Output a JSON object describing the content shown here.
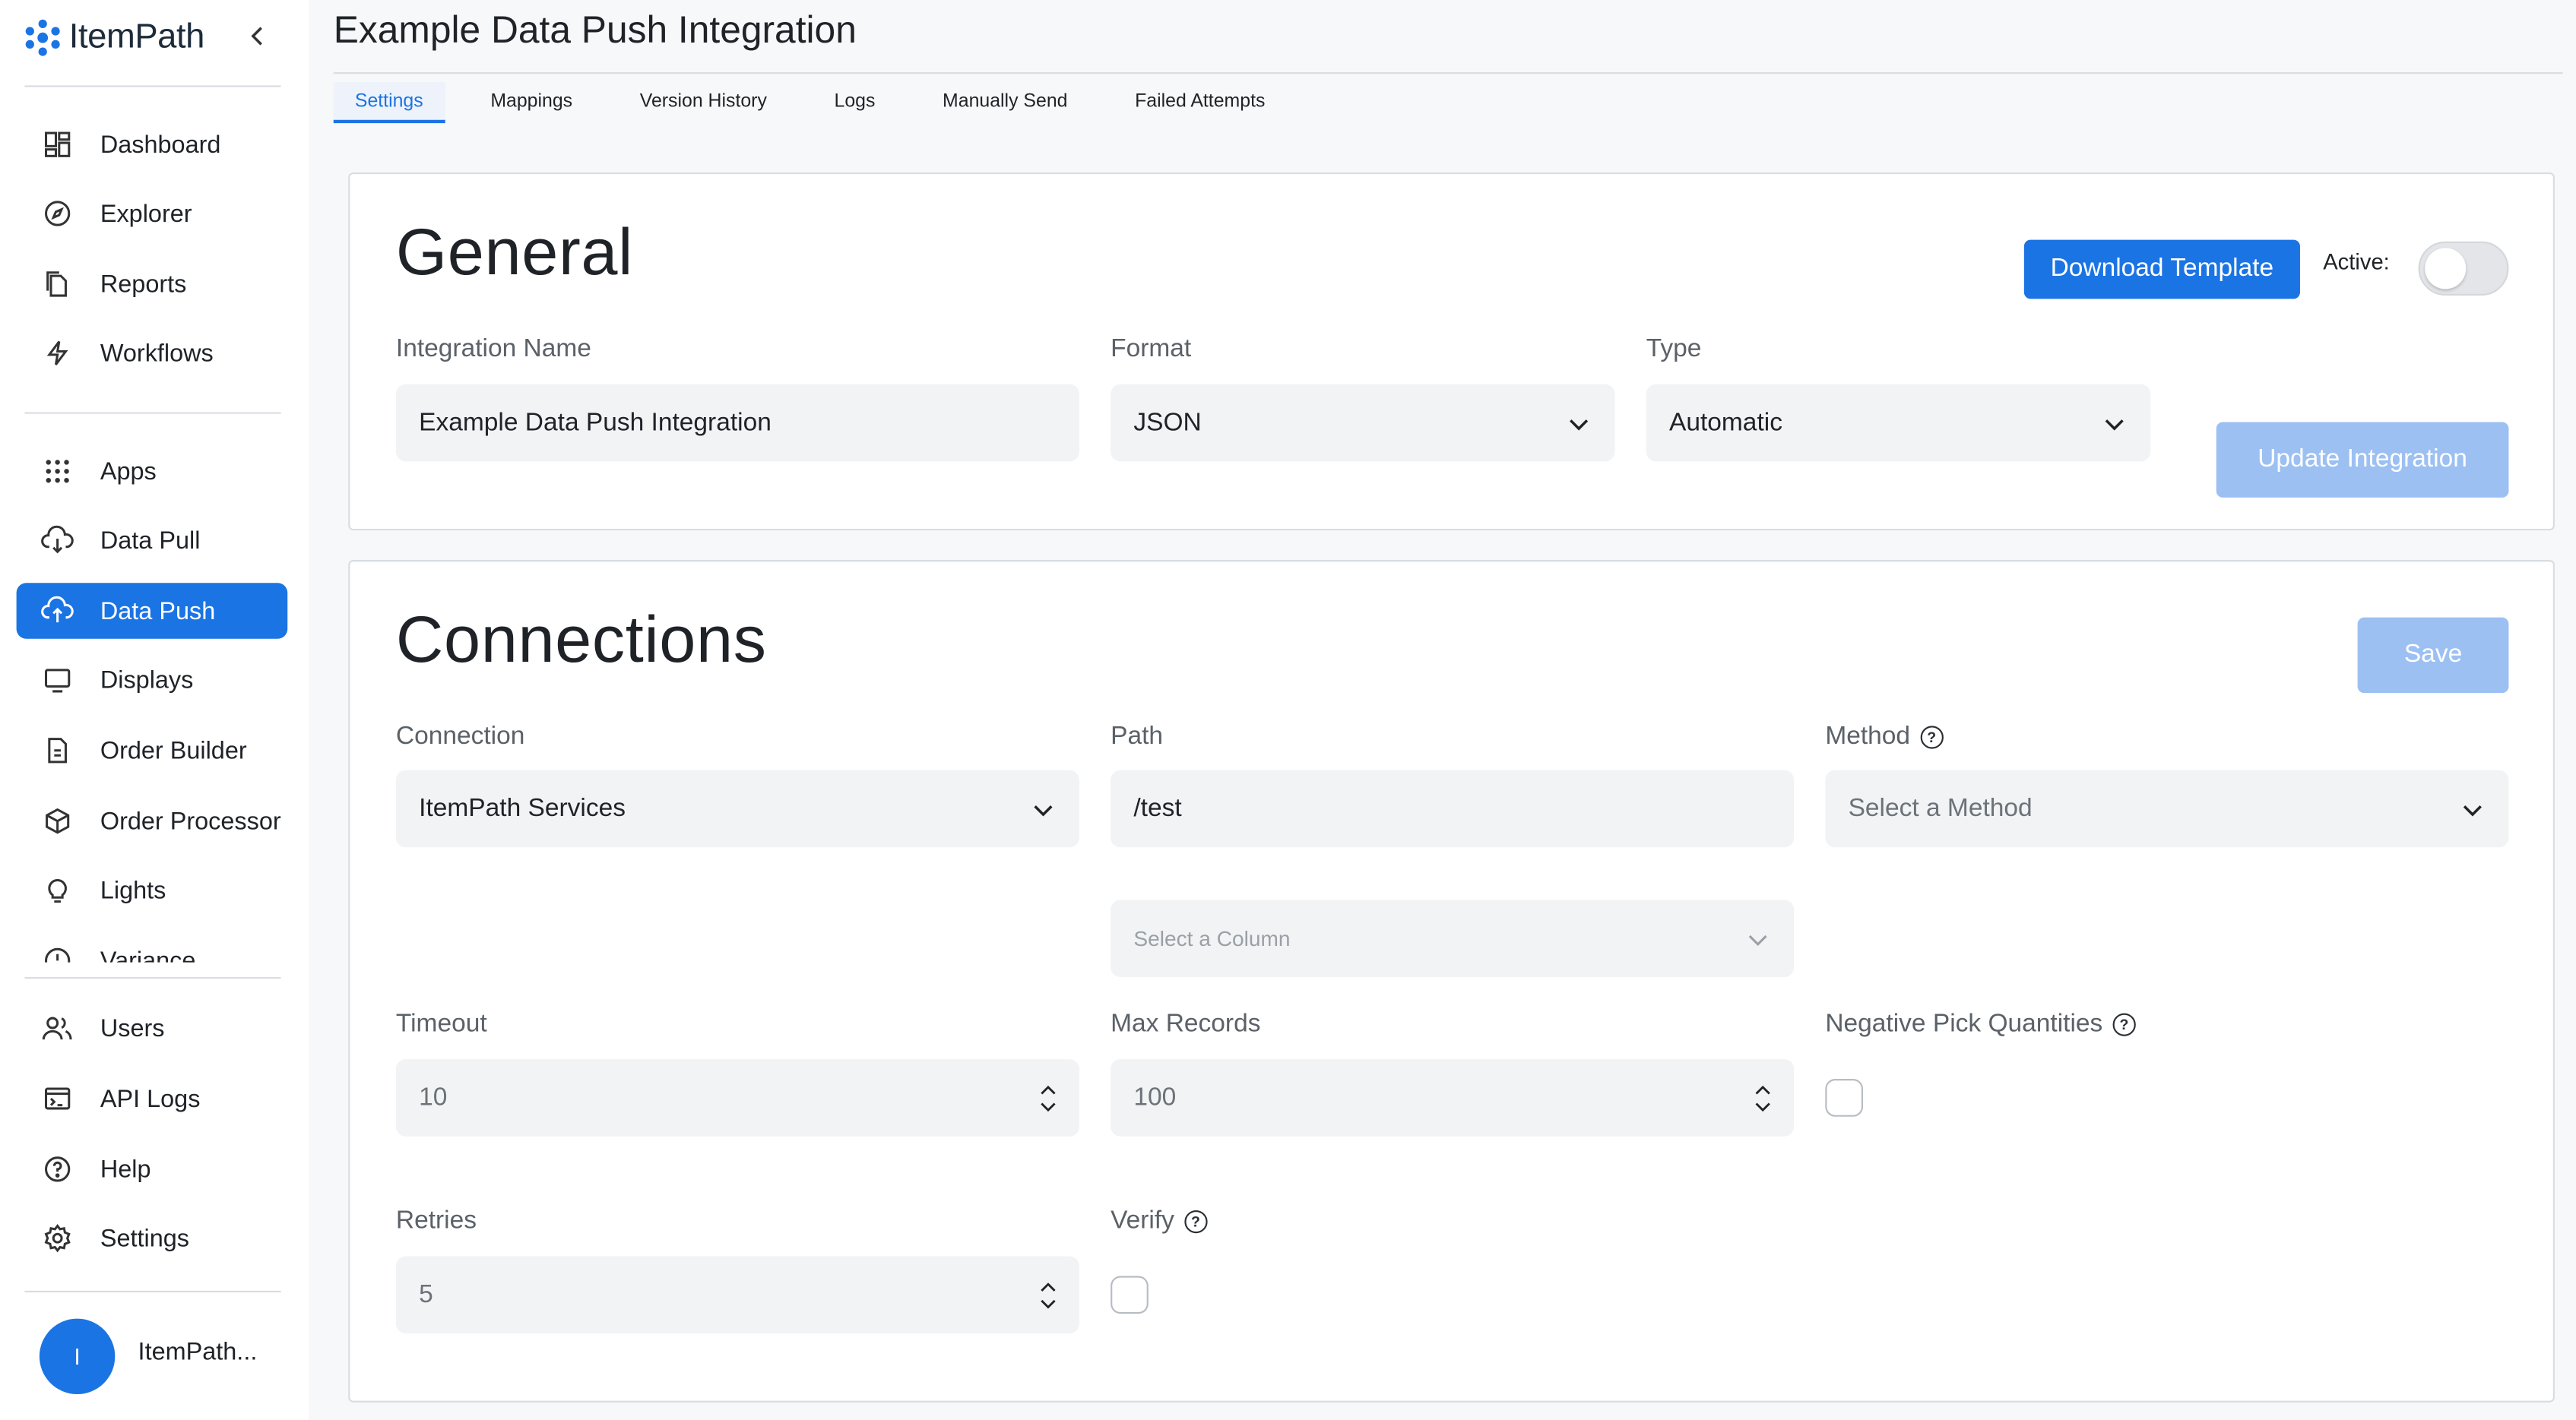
{
  "brand": {
    "name": "ItemPath"
  },
  "sidebar": {
    "group1": [
      {
        "label": "Dashboard",
        "icon": "dashboard-icon"
      },
      {
        "label": "Explorer",
        "icon": "compass-icon"
      },
      {
        "label": "Reports",
        "icon": "reports-icon"
      },
      {
        "label": "Workflows",
        "icon": "bolt-icon"
      }
    ],
    "group2": [
      {
        "label": "Apps",
        "icon": "apps-grid-icon"
      },
      {
        "label": "Data Pull",
        "icon": "cloud-download-icon"
      },
      {
        "label": "Data Push",
        "icon": "cloud-upload-icon",
        "active": true
      },
      {
        "label": "Displays",
        "icon": "monitor-icon"
      },
      {
        "label": "Order Builder",
        "icon": "document-icon"
      },
      {
        "label": "Order Processor",
        "icon": "cube-icon"
      },
      {
        "label": "Lights",
        "icon": "lightbulb-icon"
      },
      {
        "label": "Variance",
        "icon": "variance-icon"
      }
    ],
    "group3": [
      {
        "label": "Users",
        "icon": "users-icon"
      },
      {
        "label": "API Logs",
        "icon": "terminal-icon"
      },
      {
        "label": "Help",
        "icon": "help-icon"
      },
      {
        "label": "Settings",
        "icon": "gear-icon"
      }
    ],
    "user": {
      "avatar_initial": "I",
      "name": "ItemPath..."
    }
  },
  "header": {
    "title": "Example Data Push Integration"
  },
  "tabs": [
    "Settings",
    "Mappings",
    "Version History",
    "Logs",
    "Manually Send",
    "Failed Attempts"
  ],
  "general": {
    "title": "General",
    "download_template": "Download Template",
    "active_label": "Active:",
    "active_on": false,
    "integration_name_label": "Integration Name",
    "integration_name_value": "Example Data Push Integration",
    "format_label": "Format",
    "format_value": "JSON",
    "type_label": "Type",
    "type_value": "Automatic",
    "update_button": "Update Integration"
  },
  "connections": {
    "title": "Connections",
    "save_button": "Save",
    "connection_label": "Connection",
    "connection_value": "ItemPath Services",
    "path_label": "Path",
    "path_value": "/test",
    "method_label": "Method",
    "method_placeholder": "Select a Method",
    "column_placeholder": "Select a Column",
    "timeout_label": "Timeout",
    "timeout_value": "10",
    "max_records_label": "Max Records",
    "max_records_value": "100",
    "negative_pick_label": "Negative Pick Quantities",
    "negative_pick_checked": false,
    "retries_label": "Retries",
    "retries_value": "5",
    "verify_label": "Verify",
    "verify_checked": false
  },
  "colors": {
    "accent": "#1b74e4",
    "disabled_button": "#9cc0f2"
  }
}
